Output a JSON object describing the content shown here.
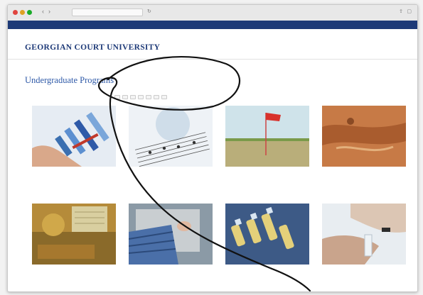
{
  "browser": {
    "address": "",
    "page_url": ""
  },
  "topbar": {
    "links": [
      "",
      "",
      "",
      "",
      "",
      ""
    ],
    "search": ""
  },
  "header": {
    "logo_name": "GEORGIAN COURT UNIVERSITY",
    "logo_tagline": "",
    "nav": [
      "",
      "",
      "",
      "",
      ""
    ]
  },
  "page": {
    "title": "Undergraduate Programs",
    "breadcrumbs": [
      "",
      "",
      ""
    ],
    "filters": [
      "",
      "",
      "",
      "",
      "",
      "",
      ""
    ]
  },
  "programs": [
    {
      "name": "",
      "category": ""
    },
    {
      "name": "",
      "category": ""
    },
    {
      "name": "",
      "category": ""
    },
    {
      "name": "",
      "category": ""
    },
    {
      "name": "",
      "category": ""
    },
    {
      "name": "",
      "category": ""
    },
    {
      "name": "",
      "category": ""
    },
    {
      "name": "",
      "category": ""
    }
  ],
  "colors": {
    "brand_blue": "#1e3a78",
    "link_blue": "#2f5aa8",
    "gold": "#c7a23a",
    "pen_stroke": "#111111"
  },
  "icons": {
    "close": "close-icon",
    "minimize": "minimize-icon",
    "maximize": "maximize-icon",
    "back": "back-arrow-icon",
    "forward": "forward-arrow-icon"
  }
}
